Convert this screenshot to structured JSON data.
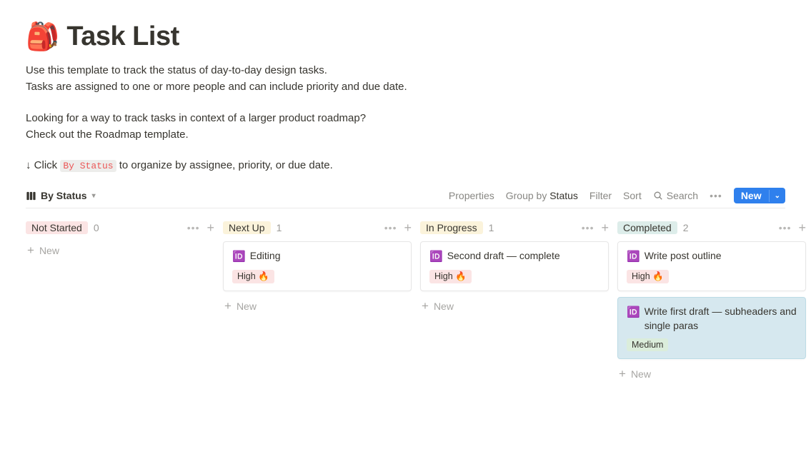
{
  "page": {
    "icon": "🎒",
    "title": "Task List",
    "desc_line1": "Use this template to track the status of day-to-day design tasks.",
    "desc_line2": "Tasks are assigned to one or more people and can include priority and due date.",
    "desc_line3": "Looking for a way to track tasks in context of a larger product roadmap?",
    "desc_line4": "Check out the Roadmap template.",
    "hint_prefix": "↓ Click ",
    "hint_code": "By Status",
    "hint_suffix": " to organize by assignee, priority, or due date."
  },
  "toolbar": {
    "view_label": "By Status",
    "properties": "Properties",
    "groupby_prefix": "Group by ",
    "groupby_value": "Status",
    "filter": "Filter",
    "sort": "Sort",
    "search": "Search",
    "new": "New"
  },
  "columns": [
    {
      "id": "notstarted",
      "label": "Not Started",
      "count": "0",
      "tag_class": "tag-notstarted",
      "cards": []
    },
    {
      "id": "nextup",
      "label": "Next Up",
      "count": "1",
      "tag_class": "tag-nextup",
      "cards": [
        {
          "icon": "🆔",
          "title": "Editing",
          "priority": "High 🔥",
          "prio_class": "prio-high"
        }
      ]
    },
    {
      "id": "inprogress",
      "label": "In Progress",
      "count": "1",
      "tag_class": "tag-inprogress",
      "cards": [
        {
          "icon": "🆔",
          "title": "Second draft — complete",
          "priority": "High 🔥",
          "prio_class": "prio-high"
        }
      ]
    },
    {
      "id": "completed",
      "label": "Completed",
      "count": "2",
      "tag_class": "tag-completed",
      "cards": [
        {
          "icon": "🆔",
          "title": "Write post outline",
          "priority": "High 🔥",
          "prio_class": "prio-high"
        },
        {
          "icon": "🆔",
          "title": "Write first draft — subheaders and single paras",
          "priority": "Medium",
          "prio_class": "prio-med",
          "highlighted": true
        }
      ]
    }
  ],
  "labels": {
    "new_card": "New"
  }
}
